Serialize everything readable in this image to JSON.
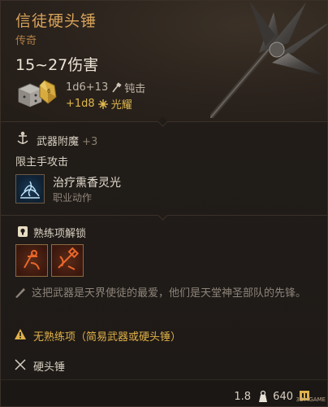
{
  "item": {
    "name": "信徒硬头锤",
    "rarity": "传奇",
    "damage_range": "15~27伤害",
    "base_damage": "1d6+13",
    "base_damage_type": "钝击",
    "extra_damage": "+1d8",
    "extra_damage_type": "光耀"
  },
  "enchant": {
    "title": "武器附魔",
    "bonus": "+3"
  },
  "mainhand": {
    "restriction": "限主手攻击",
    "spell_name": "治疗熏香灵光",
    "spell_type": "职业动作"
  },
  "proficiency": {
    "title": "熟练项解锁"
  },
  "lore": "这把武器是天界使徒的最爱，他们是天堂神圣部队的先锋。",
  "warning": "无熟练项（简易武器或硬头锤）",
  "weapon_type": "硬头锤",
  "footer": {
    "weight": "1.8",
    "value": "640",
    "watermark": "3DMGAME"
  },
  "colors": {
    "title": "#d8a35a",
    "rarity": "#b07d45",
    "radiant": "#e1b94e",
    "warning": "#e0b148"
  }
}
